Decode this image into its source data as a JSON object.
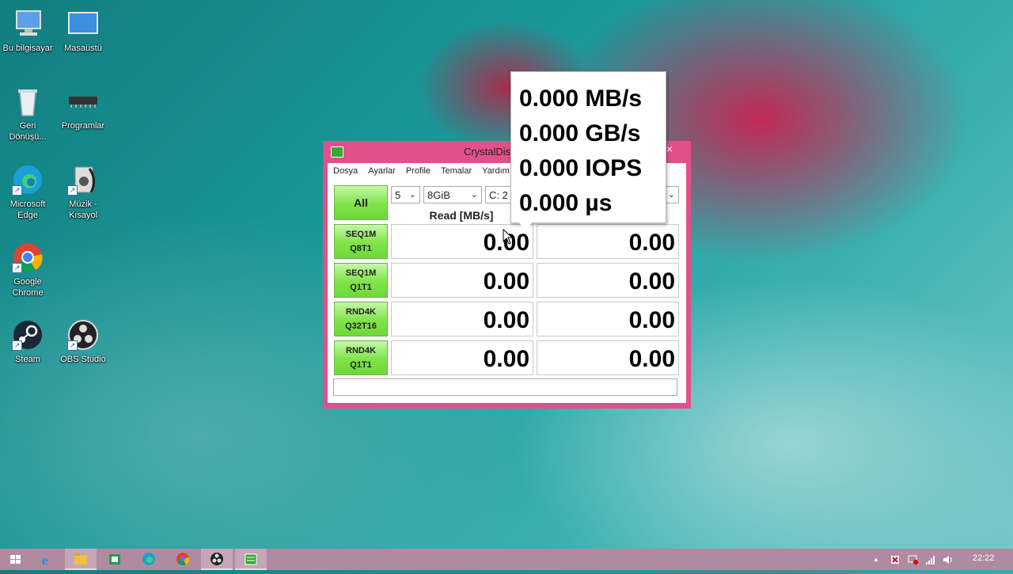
{
  "desktop": {
    "icons": [
      {
        "label": "Bu bilgisayar",
        "icon": "computer-icon"
      },
      {
        "label": "Masaüstü",
        "icon": "desktop-icon"
      },
      {
        "label": "Geri Dönüşü...",
        "icon": "recycle-bin-icon"
      },
      {
        "label": "Programlar",
        "icon": "chip-icon"
      },
      {
        "label": "Microsoft Edge",
        "icon": "edge-icon"
      },
      {
        "label": "Müzik - Kısayol",
        "icon": "music-icon"
      },
      {
        "label": "Google Chrome",
        "icon": "chrome-icon"
      },
      {
        "label": "Steam",
        "icon": "steam-icon"
      },
      {
        "label": "OBS Studio",
        "icon": "obs-icon"
      }
    ]
  },
  "window": {
    "title": "CrystalDiskMark 7.",
    "close_label": "×",
    "menu": [
      "Dosya",
      "Ayarlar",
      "Profile",
      "Temalar",
      "Yardım"
    ],
    "all_button": "All",
    "count_select": "5",
    "size_select": "8GiB",
    "drive_select": "C: 2",
    "read_header": "Read [MB/s]",
    "rows": [
      {
        "line1": "SEQ1M",
        "line2": "Q8T1",
        "read": "0.00",
        "write": "0.00"
      },
      {
        "line1": "SEQ1M",
        "line2": "Q1T1",
        "read": "0.00",
        "write": "0.00"
      },
      {
        "line1": "RND4K",
        "line2": "Q32T16",
        "read": "0.00",
        "write": "0.00"
      },
      {
        "line1": "RND4K",
        "line2": "Q1T1",
        "read": "0.00",
        "write": "0.00"
      }
    ],
    "accent": "#e1508a",
    "button_green": "#7fe34a"
  },
  "tooltip": {
    "lines": [
      "0.000 MB/s",
      "0.000 GB/s",
      "0.000 IOPS",
      "0.000 µs"
    ]
  },
  "taskbar": {
    "clock": "22:22",
    "tray_arrow": "▲"
  }
}
